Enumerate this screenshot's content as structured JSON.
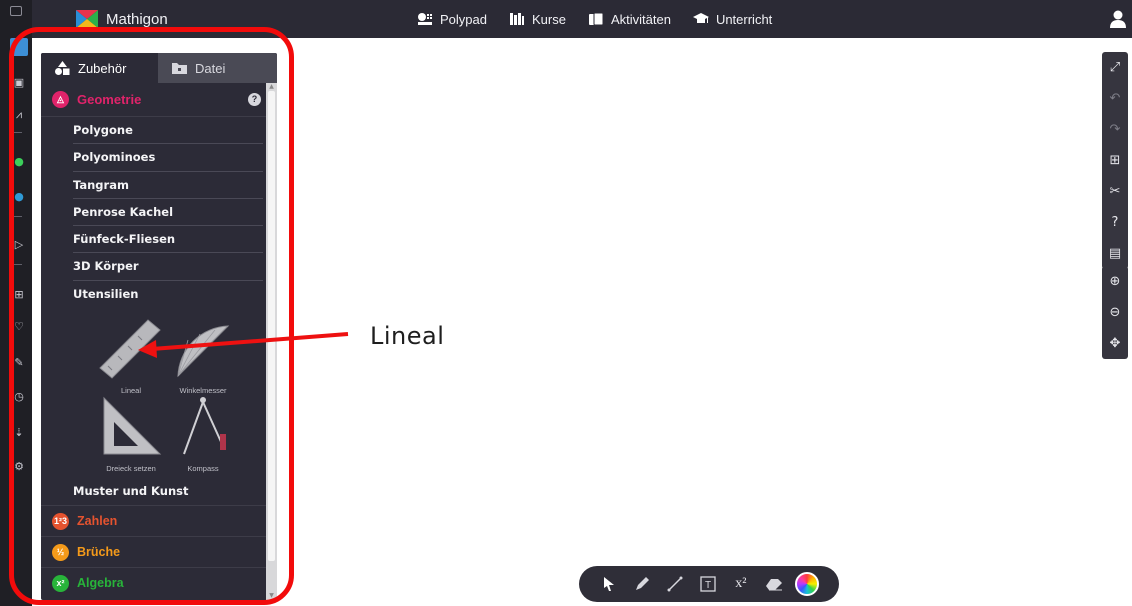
{
  "app": {
    "name": "Mathigon",
    "nav": [
      {
        "label": "Polypad",
        "icon": "polypad-icon"
      },
      {
        "label": "Kurse",
        "icon": "books-icon"
      },
      {
        "label": "Aktivitäten",
        "icon": "cards-icon"
      },
      {
        "label": "Unterricht",
        "icon": "graduation-cap-icon"
      }
    ],
    "user_icon": "user-icon"
  },
  "sidebar": {
    "tabs": [
      {
        "label": "Zubehör",
        "icon": "shapes-icon",
        "active": true
      },
      {
        "label": "Datei",
        "icon": "folder-icon",
        "active": false
      }
    ],
    "section": {
      "label": "Geometrie",
      "color": "#e0236a",
      "help": "?"
    },
    "items": [
      "Polygone",
      "Polyominoes",
      "Tangram",
      "Penrose Kachel",
      "Fünfeck-Fliesen",
      "3D Körper",
      "Utensilien"
    ],
    "tools": [
      {
        "label": "Lineal",
        "icon": "ruler-icon"
      },
      {
        "label": "Winkelmesser",
        "icon": "protractor-icon"
      },
      {
        "label": "Dreieck setzen",
        "icon": "set-square-icon"
      },
      {
        "label": "Kompass",
        "icon": "compass-icon"
      }
    ],
    "muster": "Muster und Kunst",
    "categories": [
      {
        "label": "Zahlen",
        "badge": "1²3",
        "color": "#e5532f"
      },
      {
        "label": "Brüche",
        "badge": "½",
        "color": "#f49a1a"
      },
      {
        "label": "Algebra",
        "badge": "x²",
        "color": "#28b43a"
      }
    ]
  },
  "annotation": {
    "label": "Lineal",
    "highlight_color": "#f20b0b"
  },
  "right_toolbar": [
    "fullscreen-icon",
    "undo-icon",
    "redo-icon",
    "grid-icon",
    "tools-icon",
    "help-icon",
    "export-icon",
    "zoom-in-icon",
    "zoom-out-icon",
    "pan-icon"
  ],
  "bottom_toolbar": [
    "select-icon",
    "pen-icon",
    "line-icon",
    "text-icon",
    "x²",
    "eraser-icon",
    "color-wheel-icon"
  ]
}
